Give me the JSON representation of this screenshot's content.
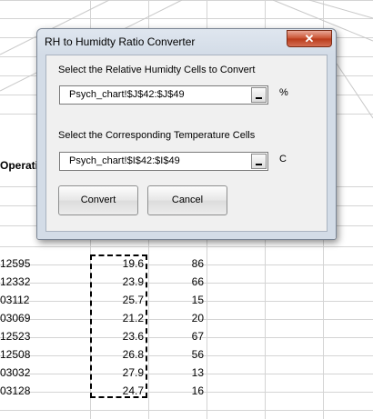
{
  "dialog": {
    "title": "RH to Humidty Ratio Converter",
    "close_icon": "close-icon",
    "rh_prompt": "Select the Relative Humidty Cells to Convert",
    "rh_range": "Psych_chart!$J$42:$J$49",
    "rh_unit": "%",
    "temp_prompt": "Select the Corresponding Temperature Cells",
    "temp_range": "Psych_chart!$I$42:$I$49",
    "temp_unit": "C",
    "convert_label": "Convert",
    "cancel_label": "Cancel"
  },
  "sheet": {
    "header_fragment": "Operati",
    "rows": [
      {
        "a": "12595",
        "b": "19.6",
        "c": "86"
      },
      {
        "a": "12332",
        "b": "23.9",
        "c": "66"
      },
      {
        "a": "03112",
        "b": "25.7",
        "c": "15"
      },
      {
        "a": "03069",
        "b": "21.2",
        "c": "20"
      },
      {
        "a": "12523",
        "b": "23.6",
        "c": "67"
      },
      {
        "a": "12508",
        "b": "26.8",
        "c": "56"
      },
      {
        "a": "03032",
        "b": "27.9",
        "c": "13"
      },
      {
        "a": "03128",
        "b": "24.7",
        "c": "16"
      }
    ]
  }
}
